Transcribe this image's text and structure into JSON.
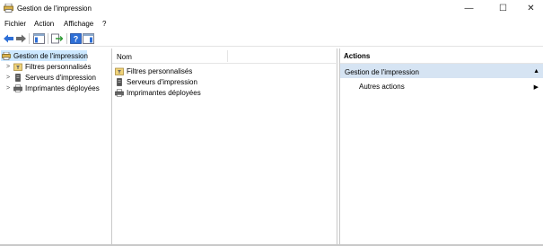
{
  "window": {
    "title": "Gestion de l'impression",
    "controls": {
      "minimize": "—",
      "maximize": "☐",
      "close": "✕"
    }
  },
  "menu": [
    "Fichier",
    "Action",
    "Affichage",
    "?"
  ],
  "toolbar": {
    "buttons": [
      "back-arrow-icon",
      "forward-arrow-icon",
      "show-hide-tree-icon",
      "export-list-icon",
      "help-icon",
      "show-hide-action-pane-icon"
    ]
  },
  "tree": {
    "root": "Gestion de l'impression",
    "items": [
      {
        "label": "Filtres personnalisés",
        "icon": "filter-folder-icon"
      },
      {
        "label": "Serveurs d'impression",
        "icon": "server-icon"
      },
      {
        "label": "Imprimantes déployées",
        "icon": "printer-icon"
      }
    ]
  },
  "list": {
    "column": "Nom",
    "rows": [
      {
        "label": "Filtres personnalisés",
        "icon": "filter-folder-icon"
      },
      {
        "label": "Serveurs d'impression",
        "icon": "server-icon"
      },
      {
        "label": "Imprimantes déployées",
        "icon": "printer-icon"
      }
    ]
  },
  "actions": {
    "title": "Actions",
    "section": "Gestion de l'impression",
    "items": [
      "Autres actions"
    ]
  },
  "colors": {
    "selection": "#cce8ff",
    "section_header": "#d6e4f3",
    "back_arrow": "#2e6fd6",
    "forward_arrow": "#6b6b6b"
  }
}
